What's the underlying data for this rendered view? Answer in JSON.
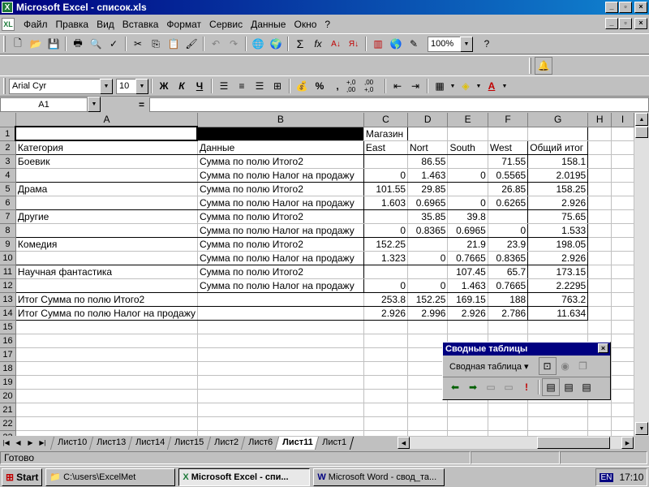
{
  "window": {
    "title": "Microsoft Excel - список.xls",
    "min": "_",
    "max": "▫",
    "close": "×"
  },
  "menu": {
    "items": [
      "Файл",
      "Правка",
      "Вид",
      "Вставка",
      "Формат",
      "Сервис",
      "Данные",
      "Окно",
      "?"
    ]
  },
  "standard_toolbar": {
    "zoom": "100%"
  },
  "format_toolbar": {
    "font": "Arial Cyr",
    "size": "10",
    "bold": "Ж",
    "italic": "К",
    "underline": "Ч",
    "percent": "%",
    "comma": ",",
    "inc_dec": "+,0 ,00",
    "dec_dec": ",00 +,0"
  },
  "formula_bar": {
    "name_box": "A1",
    "equals": "="
  },
  "columns": [
    "A",
    "B",
    "C",
    "D",
    "E",
    "F",
    "G",
    "H",
    "I"
  ],
  "rows": [
    {
      "n": "1",
      "cells": [
        "",
        "",
        "Магазин",
        "",
        "",
        "",
        "",
        "",
        ""
      ]
    },
    {
      "n": "2",
      "cells": [
        "Категория",
        "Данные",
        "East",
        "Nort",
        "South",
        "West",
        "Общий итог",
        "",
        ""
      ]
    },
    {
      "n": "3",
      "cells": [
        "Боевик",
        "Сумма по полю Итого2",
        "",
        "86.55",
        "",
        "71.55",
        "158.1",
        "",
        ""
      ]
    },
    {
      "n": "4",
      "cells": [
        "",
        "Сумма по полю Налог на продажу",
        "0",
        "1.463",
        "0",
        "0.5565",
        "2.0195",
        "",
        ""
      ]
    },
    {
      "n": "5",
      "cells": [
        "Драма",
        "Сумма по полю Итого2",
        "101.55",
        "29.85",
        "",
        "26.85",
        "158.25",
        "",
        ""
      ]
    },
    {
      "n": "6",
      "cells": [
        "",
        "Сумма по полю Налог на продажу",
        "1.603",
        "0.6965",
        "0",
        "0.6265",
        "2.926",
        "",
        ""
      ]
    },
    {
      "n": "7",
      "cells": [
        "Другие",
        "Сумма по полю Итого2",
        "",
        "35.85",
        "39.8",
        "",
        "75.65",
        "",
        ""
      ]
    },
    {
      "n": "8",
      "cells": [
        "",
        "Сумма по полю Налог на продажу",
        "0",
        "0.8365",
        "0.6965",
        "0",
        "1.533",
        "",
        ""
      ]
    },
    {
      "n": "9",
      "cells": [
        "Комедия",
        "Сумма по полю Итого2",
        "152.25",
        "",
        "21.9",
        "23.9",
        "198.05",
        "",
        ""
      ]
    },
    {
      "n": "10",
      "cells": [
        "",
        "Сумма по полю Налог на продажу",
        "1.323",
        "0",
        "0.7665",
        "0.8365",
        "2.926",
        "",
        ""
      ]
    },
    {
      "n": "11",
      "cells": [
        "Научная фантастика",
        "Сумма по полю Итого2",
        "",
        "",
        "107.45",
        "65.7",
        "173.15",
        "",
        ""
      ]
    },
    {
      "n": "12",
      "cells": [
        "",
        "Сумма по полю Налог на продажу",
        "0",
        "0",
        "1.463",
        "0.7665",
        "2.2295",
        "",
        ""
      ]
    },
    {
      "n": "13",
      "cells": [
        "Итог Сумма по полю Итого2",
        "",
        "253.8",
        "152.25",
        "169.15",
        "188",
        "763.2",
        "",
        ""
      ]
    },
    {
      "n": "14",
      "cells": [
        "Итог Сумма по полю Налог на продажу",
        "",
        "2.926",
        "2.996",
        "2.926",
        "2.786",
        "11.634",
        "",
        ""
      ]
    },
    {
      "n": "15",
      "cells": [
        "",
        "",
        "",
        "",
        "",
        "",
        "",
        "",
        ""
      ]
    },
    {
      "n": "16",
      "cells": [
        "",
        "",
        "",
        "",
        "",
        "",
        "",
        "",
        ""
      ]
    },
    {
      "n": "17",
      "cells": [
        "",
        "",
        "",
        "",
        "",
        "",
        "",
        "",
        ""
      ]
    },
    {
      "n": "18",
      "cells": [
        "",
        "",
        "",
        "",
        "",
        "",
        "",
        "",
        ""
      ]
    },
    {
      "n": "19",
      "cells": [
        "",
        "",
        "",
        "",
        "",
        "",
        "",
        "",
        ""
      ]
    },
    {
      "n": "20",
      "cells": [
        "",
        "",
        "",
        "",
        "",
        "",
        "",
        "",
        ""
      ]
    },
    {
      "n": "21",
      "cells": [
        "",
        "",
        "",
        "",
        "",
        "",
        "",
        "",
        ""
      ]
    },
    {
      "n": "22",
      "cells": [
        "",
        "",
        "",
        "",
        "",
        "",
        "",
        "",
        ""
      ]
    },
    {
      "n": "23",
      "cells": [
        "",
        "",
        "",
        "",
        "",
        "",
        "",
        "",
        ""
      ]
    }
  ],
  "sheet_tabs": [
    "Лист10",
    "Лист13",
    "Лист14",
    "Лист15",
    "Лист2",
    "Лист6",
    "Лист11",
    "Лист1"
  ],
  "active_tab": "Лист11",
  "status": {
    "text": "Готово"
  },
  "pivot_toolbar": {
    "title": "Сводные таблицы",
    "menu": "Сводная таблица ▾",
    "close": "×"
  },
  "taskbar": {
    "start": "Start",
    "tasks": [
      "C:\\users\\ExcelMet",
      "Microsoft Excel - спи...",
      "Microsoft Word - свод_та..."
    ],
    "lang": "EN",
    "clock": "17:10"
  }
}
